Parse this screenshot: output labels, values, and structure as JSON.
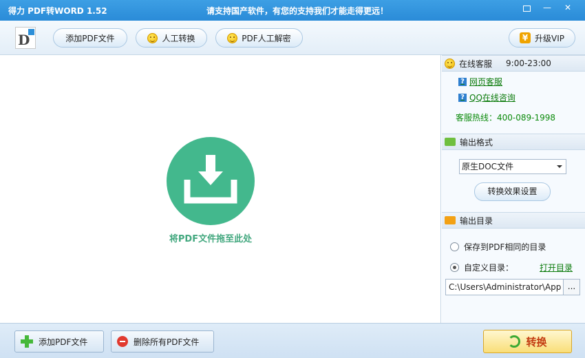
{
  "titlebar": {
    "app_title": "得力 PDF转WORD 1.52",
    "slogan": "请支持国产软件，有您的支持我们才能走得更远！",
    "minimize": "—",
    "close": "✕"
  },
  "toolbar": {
    "add_pdf": "添加PDF文件",
    "manual_convert": "人工转换",
    "pdf_decrypt": "PDF人工解密",
    "upgrade_vip": "升级VIP",
    "vip_symbol": "¥"
  },
  "drop_area": {
    "hint": "将PDF文件拖至此处"
  },
  "service": {
    "title": "在线客服",
    "hours": "9:00-23:00",
    "web_service": "网页客服",
    "qq_consult": "QQ在线咨询",
    "hotline": "客服热线：400-089-1998",
    "link_icon_glyph": "?"
  },
  "output_format": {
    "title": "输出格式",
    "selected": "原生DOC文件",
    "effect_settings": "转换效果设置"
  },
  "output_dir": {
    "title": "输出目录",
    "same_dir_label": "保存到PDF相同的目录",
    "custom_dir_label": "自定义目录：",
    "open_dir": "打开目录",
    "path": "C:\\Users\\Administrator\\App",
    "browse": "...",
    "selected_option": "custom"
  },
  "bottombar": {
    "add_pdf": "添加PDF文件",
    "delete_all": "删除所有PDF文件",
    "convert": "转换"
  },
  "colors": {
    "titlebar": "#2a8bd8",
    "drop_circle": "#43b88d",
    "link_green": "#0a7a0a",
    "convert_text": "#c23a10"
  }
}
